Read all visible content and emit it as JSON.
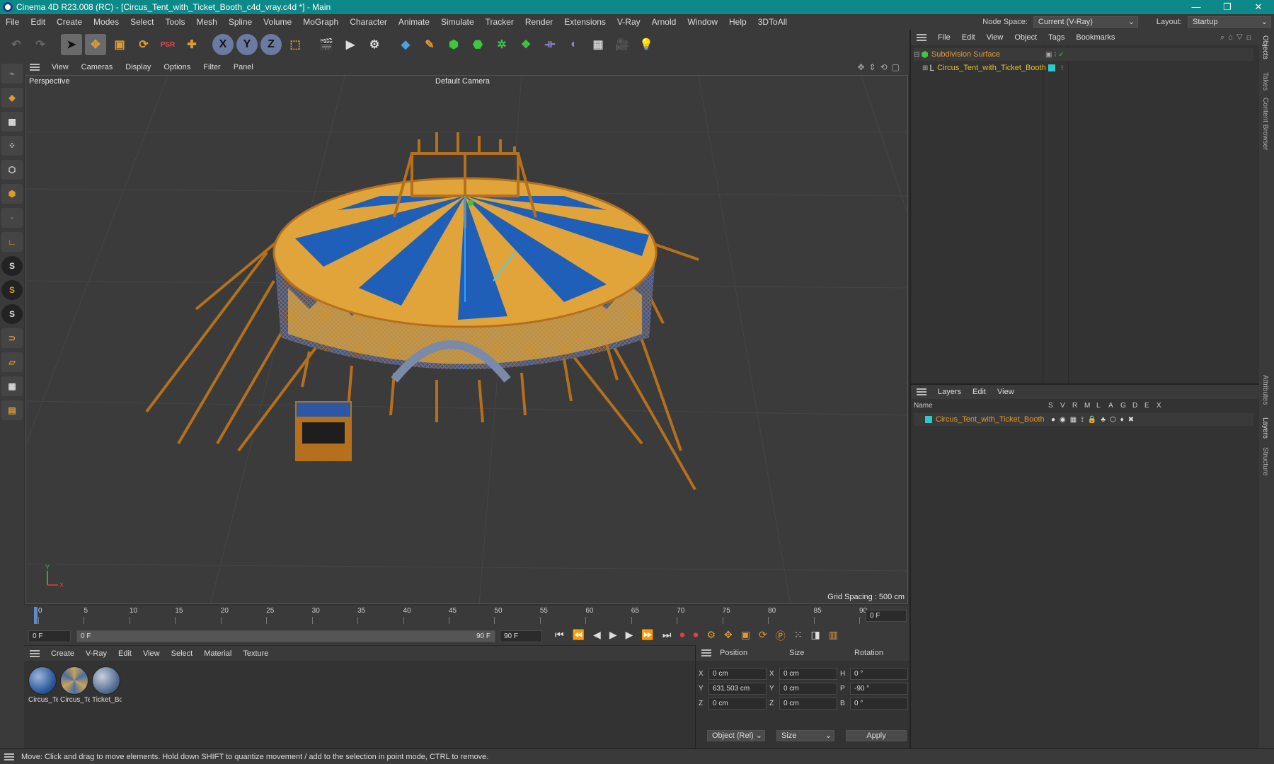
{
  "window": {
    "title": "Cinema 4D R23.008 (RC) - [Circus_Tent_with_Ticket_Booth_c4d_vray.c4d *] - Main",
    "controls": [
      "—",
      "❐",
      "✕"
    ]
  },
  "menubar": {
    "items": [
      "File",
      "Edit",
      "Create",
      "Modes",
      "Select",
      "Tools",
      "Mesh",
      "Spline",
      "Volume",
      "MoGraph",
      "Character",
      "Animate",
      "Simulate",
      "Tracker",
      "Render",
      "Extensions",
      "V-Ray",
      "Arnold",
      "Window",
      "Help",
      "3DToAll"
    ],
    "node_space_label": "Node Space:",
    "node_space_value": "Current (V-Ray)",
    "layout_label": "Layout:",
    "layout_value": "Startup"
  },
  "viewport_menu": [
    "View",
    "Cameras",
    "Display",
    "Options",
    "Filter",
    "Panel"
  ],
  "viewport": {
    "view_name": "Perspective",
    "camera": "Default Camera",
    "grid_spacing": "Grid Spacing : 500 cm"
  },
  "timeline": {
    "ticks": [
      "0",
      "5",
      "10",
      "15",
      "20",
      "25",
      "30",
      "35",
      "40",
      "45",
      "50",
      "55",
      "60",
      "65",
      "70",
      "75",
      "80",
      "85",
      "90"
    ],
    "current_frame": "0 F"
  },
  "transport": {
    "start": "0 F",
    "range_start": "0 F",
    "range_end": "90 F",
    "end": "90 F"
  },
  "material_menu": [
    "Create",
    "V-Ray",
    "Edit",
    "View",
    "Select",
    "Material",
    "Texture"
  ],
  "materials": [
    {
      "label": "Circus_Te",
      "color": "#2f5f9f"
    },
    {
      "label": "Circus_Te",
      "color": "#4d6e9e"
    },
    {
      "label": "Ticket_Bo",
      "color": "#5c7296"
    }
  ],
  "coordinates": {
    "headers": [
      "Position",
      "Size",
      "Rotation"
    ],
    "rows": [
      {
        "axis": "X",
        "pos": "0 cm",
        "size_axis": "X",
        "size": "0 cm",
        "rot_axis": "H",
        "rot": "0 °"
      },
      {
        "axis": "Y",
        "pos": "631.503 cm",
        "size_axis": "Y",
        "size": "0 cm",
        "rot_axis": "P",
        "rot": "-90 °"
      },
      {
        "axis": "Z",
        "pos": "0 cm",
        "size_axis": "Z",
        "size": "0 cm",
        "rot_axis": "B",
        "rot": "0 °"
      }
    ],
    "mode": "Object (Rel)",
    "size_mode": "Size",
    "apply": "Apply"
  },
  "objects_menu": [
    "File",
    "Edit",
    "View",
    "Object",
    "Tags",
    "Bookmarks"
  ],
  "objects": [
    {
      "name": "Subdivision Surface",
      "color": "#e39a2c"
    },
    {
      "name": "Circus_Tent_with_Ticket_Booth",
      "color": "#e3c02c"
    }
  ],
  "layers_menu": [
    "Layers",
    "Edit",
    "View"
  ],
  "layers_columns": [
    "Name",
    "S",
    "V",
    "R",
    "M",
    "L",
    "A",
    "G",
    "D",
    "E",
    "X"
  ],
  "layers": [
    {
      "name": "Circus_Tent_with_Ticket_Booth",
      "color": "#2ec9c9"
    }
  ],
  "side_tabs": [
    "Objects",
    "Takes",
    "Content Browser",
    "Attributes",
    "Layers",
    "Structure"
  ],
  "status": "Move: Click and drag to move elements. Hold down SHIFT to quantize movement / add to the selection in point mode, CTRL to remove.",
  "colors": {
    "accent": "#0e8989",
    "tent_yellow": "#e0a43a",
    "tent_blue": "#1f5fb8",
    "wire": "#b5701e"
  }
}
